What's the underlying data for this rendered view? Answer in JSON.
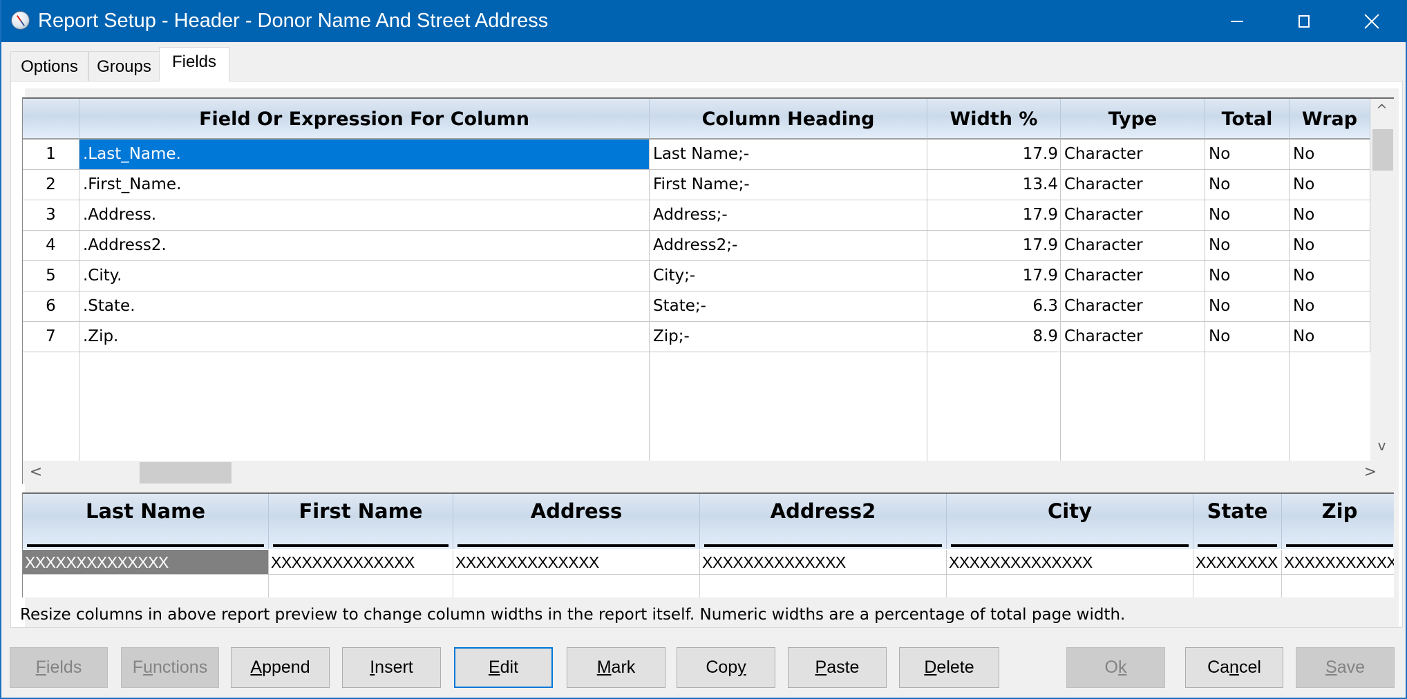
{
  "window": {
    "title": "Report Setup - Header - Donor Name And Street Address",
    "icon": "compass-icon",
    "controls": {
      "minimize": "minimize-icon",
      "maximize": "maximize-icon",
      "close": "close-icon"
    }
  },
  "tabs": [
    {
      "label": "Options",
      "active": false
    },
    {
      "label": "Groups",
      "active": false
    },
    {
      "label": "Fields",
      "active": true
    }
  ],
  "fields_grid": {
    "columns": [
      "",
      "Field Or Expression For Column",
      "Column Heading",
      "Width %",
      "Type",
      "Total",
      "Wrap"
    ],
    "rows": [
      {
        "num": "1",
        "field": ".Last_Name.",
        "heading": "Last Name;-",
        "width": "17.9",
        "type": "Character",
        "total": "No",
        "wrap": "No",
        "selected": true
      },
      {
        "num": "2",
        "field": ".First_Name.",
        "heading": "First Name;-",
        "width": "13.4",
        "type": "Character",
        "total": "No",
        "wrap": "No"
      },
      {
        "num": "3",
        "field": ".Address.",
        "heading": "Address;-",
        "width": "17.9",
        "type": "Character",
        "total": "No",
        "wrap": "No"
      },
      {
        "num": "4",
        "field": ".Address2.",
        "heading": "Address2;-",
        "width": "17.9",
        "type": "Character",
        "total": "No",
        "wrap": "No"
      },
      {
        "num": "5",
        "field": ".City.",
        "heading": "City;-",
        "width": "17.9",
        "type": "Character",
        "total": "No",
        "wrap": "No"
      },
      {
        "num": "6",
        "field": ".State.",
        "heading": "State;-",
        "width": "6.3",
        "type": "Character",
        "total": "No",
        "wrap": "No"
      },
      {
        "num": "7",
        "field": ".Zip.",
        "heading": "Zip;-",
        "width": "8.9",
        "type": "Character",
        "total": "No",
        "wrap": "No"
      }
    ],
    "scroll": {
      "up": "^",
      "down": "v",
      "left": "<",
      "right": ">"
    }
  },
  "preview": {
    "columns": [
      {
        "heading": "Last Name",
        "sample": "XXXXXXXXXXXXXX"
      },
      {
        "heading": "First Name",
        "sample": "XXXXXXXXXXXXXX"
      },
      {
        "heading": "Address",
        "sample": "XXXXXXXXXXXXXX"
      },
      {
        "heading": "Address2",
        "sample": "XXXXXXXXXXXXXX"
      },
      {
        "heading": "City",
        "sample": "XXXXXXXXXXXXXX"
      },
      {
        "heading": "State",
        "sample": "XXXXXXXX"
      },
      {
        "heading": "Zip",
        "sample": "XXXXXXXXXXXX"
      }
    ]
  },
  "status_text": "Resize columns in above report preview to change column widths in the report itself. Numeric widths are a percentage of total page width.",
  "buttons": [
    {
      "label": "Fields",
      "mnemonic_index": 0,
      "enabled": false
    },
    {
      "label": "Functions",
      "mnemonic_index": 1,
      "enabled": false
    },
    {
      "label": "Append",
      "mnemonic_index": 0,
      "enabled": true
    },
    {
      "label": "Insert",
      "mnemonic_index": 0,
      "enabled": true
    },
    {
      "label": "Edit",
      "mnemonic_index": 0,
      "enabled": true,
      "focused": true
    },
    {
      "label": "Mark",
      "mnemonic_index": 0,
      "enabled": true
    },
    {
      "label": "Copy",
      "mnemonic_index": 3,
      "enabled": true
    },
    {
      "label": "Paste",
      "mnemonic_index": 0,
      "enabled": true
    },
    {
      "label": "Delete",
      "mnemonic_index": 0,
      "enabled": true
    },
    {
      "label": "Ok",
      "mnemonic_index": 1,
      "enabled": false
    },
    {
      "label": "Cancel",
      "mnemonic_index": 2,
      "enabled": true
    },
    {
      "label": "Save",
      "mnemonic_index": 0,
      "enabled": false
    }
  ],
  "colors": {
    "titlebar": "#0063b1",
    "selection": "#0078d7",
    "preview_selection": "#808080",
    "focus_border": "#0078d7"
  }
}
